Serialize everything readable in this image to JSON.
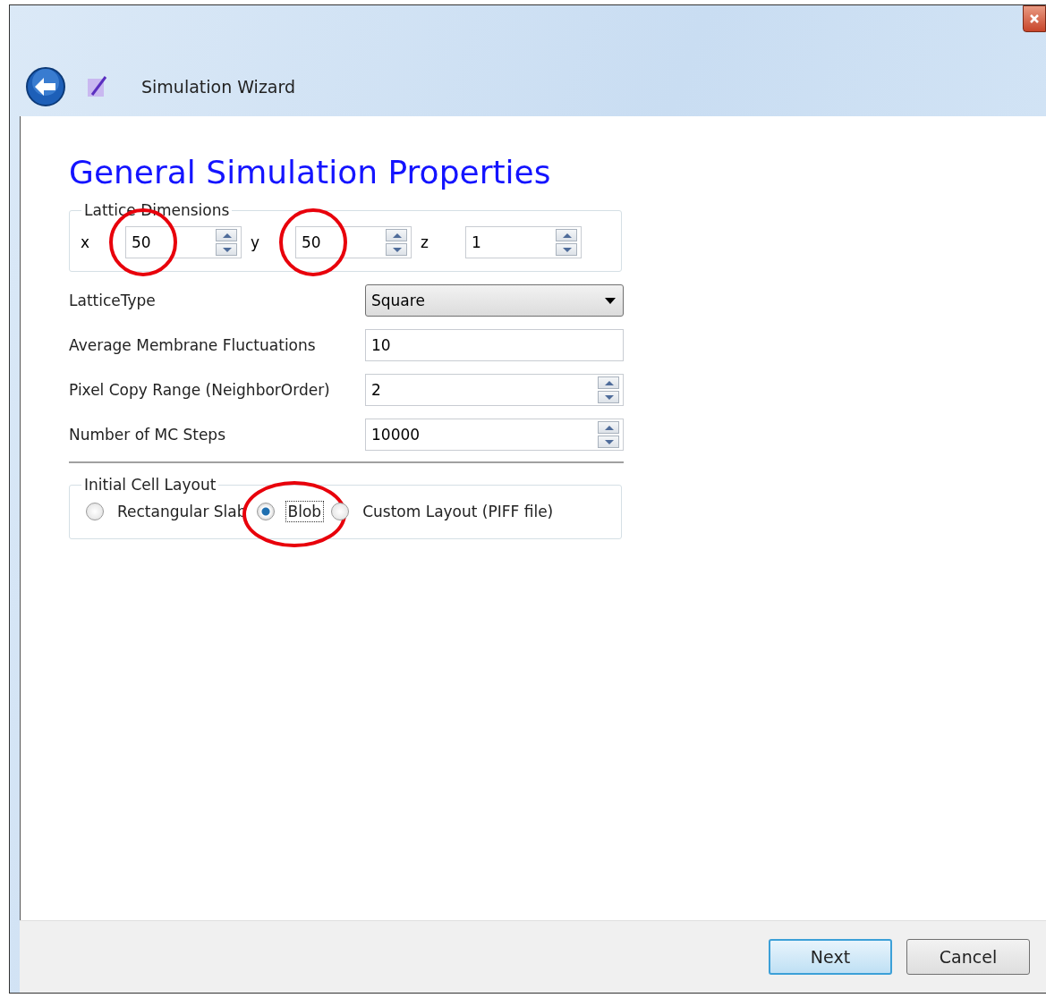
{
  "window": {
    "title": "Simulation Wizard"
  },
  "page_title": "General Simulation Properties",
  "lattice_dimensions": {
    "title": "Lattice Dimensions",
    "fields": [
      {
        "label": "x",
        "value": "50",
        "circled": true
      },
      {
        "label": "y",
        "value": "50",
        "circled": true
      },
      {
        "label": "z",
        "value": "1",
        "circled": false
      }
    ]
  },
  "properties": [
    {
      "kind": "dropdown",
      "label": "LatticeType",
      "value": "Square"
    },
    {
      "kind": "text",
      "label": "Average Membrane Fluctuations",
      "value": "10"
    },
    {
      "kind": "spin",
      "label": "Pixel Copy Range (NeighborOrder)",
      "value": "2"
    },
    {
      "kind": "spin",
      "label": "Number of MC Steps",
      "value": "10000"
    }
  ],
  "initial_cell_layout": {
    "title": "Initial Cell Layout",
    "options": [
      {
        "label": "Rectangular Slab",
        "selected": false,
        "circled": false
      },
      {
        "label": "Blob",
        "selected": true,
        "circled": true
      },
      {
        "label": "Custom Layout (PIFF file)",
        "selected": false,
        "circled": false
      }
    ]
  },
  "buttons": [
    {
      "label": "Next",
      "default": true
    },
    {
      "label": "Cancel",
      "default": false
    }
  ]
}
